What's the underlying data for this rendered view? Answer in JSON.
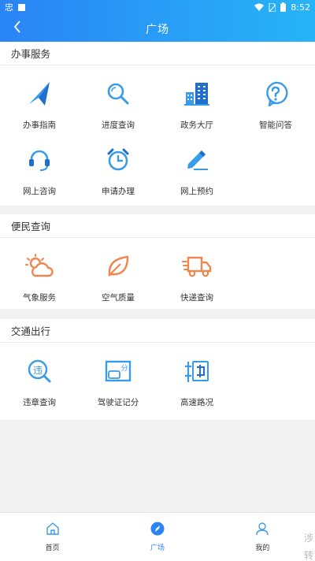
{
  "status_bar": {
    "time": "8:52",
    "app_glyph": "忠"
  },
  "header": {
    "title": "广场"
  },
  "sections": [
    {
      "title": "办事服务",
      "items": [
        {
          "label": "办事指南",
          "icon": "compass-icon"
        },
        {
          "label": "进度查询",
          "icon": "search-icon"
        },
        {
          "label": "政务大厅",
          "icon": "building-icon"
        },
        {
          "label": "智能问答",
          "icon": "question-icon"
        },
        {
          "label": "网上咨询",
          "icon": "headset-icon"
        },
        {
          "label": "申请办理",
          "icon": "alarm-clock-icon"
        },
        {
          "label": "网上预约",
          "icon": "pencil-icon"
        }
      ]
    },
    {
      "title": "便民查询",
      "items": [
        {
          "label": "气象服务",
          "icon": "weather-icon"
        },
        {
          "label": "空气质量",
          "icon": "leaf-icon"
        },
        {
          "label": "快递查询",
          "icon": "truck-icon"
        }
      ]
    },
    {
      "title": "交通出行",
      "items": [
        {
          "label": "违章查询",
          "icon": "violation-search-icon"
        },
        {
          "label": "驾驶证记分",
          "icon": "license-points-icon"
        },
        {
          "label": "高速路况",
          "icon": "highway-icon"
        }
      ]
    }
  ],
  "tabbar": {
    "items": [
      {
        "label": "首页",
        "icon": "home-icon"
      },
      {
        "label": "广场",
        "icon": "plaza-icon",
        "active": true
      },
      {
        "label": "我的",
        "icon": "user-icon"
      }
    ]
  },
  "watermark": "涉转",
  "colors": {
    "header_start": "#2a84f5",
    "header_end": "#27b4f7",
    "blue_icon": "#3a9be8",
    "orange_icon": "#f0864d",
    "active_tab": "#2a84f5"
  }
}
